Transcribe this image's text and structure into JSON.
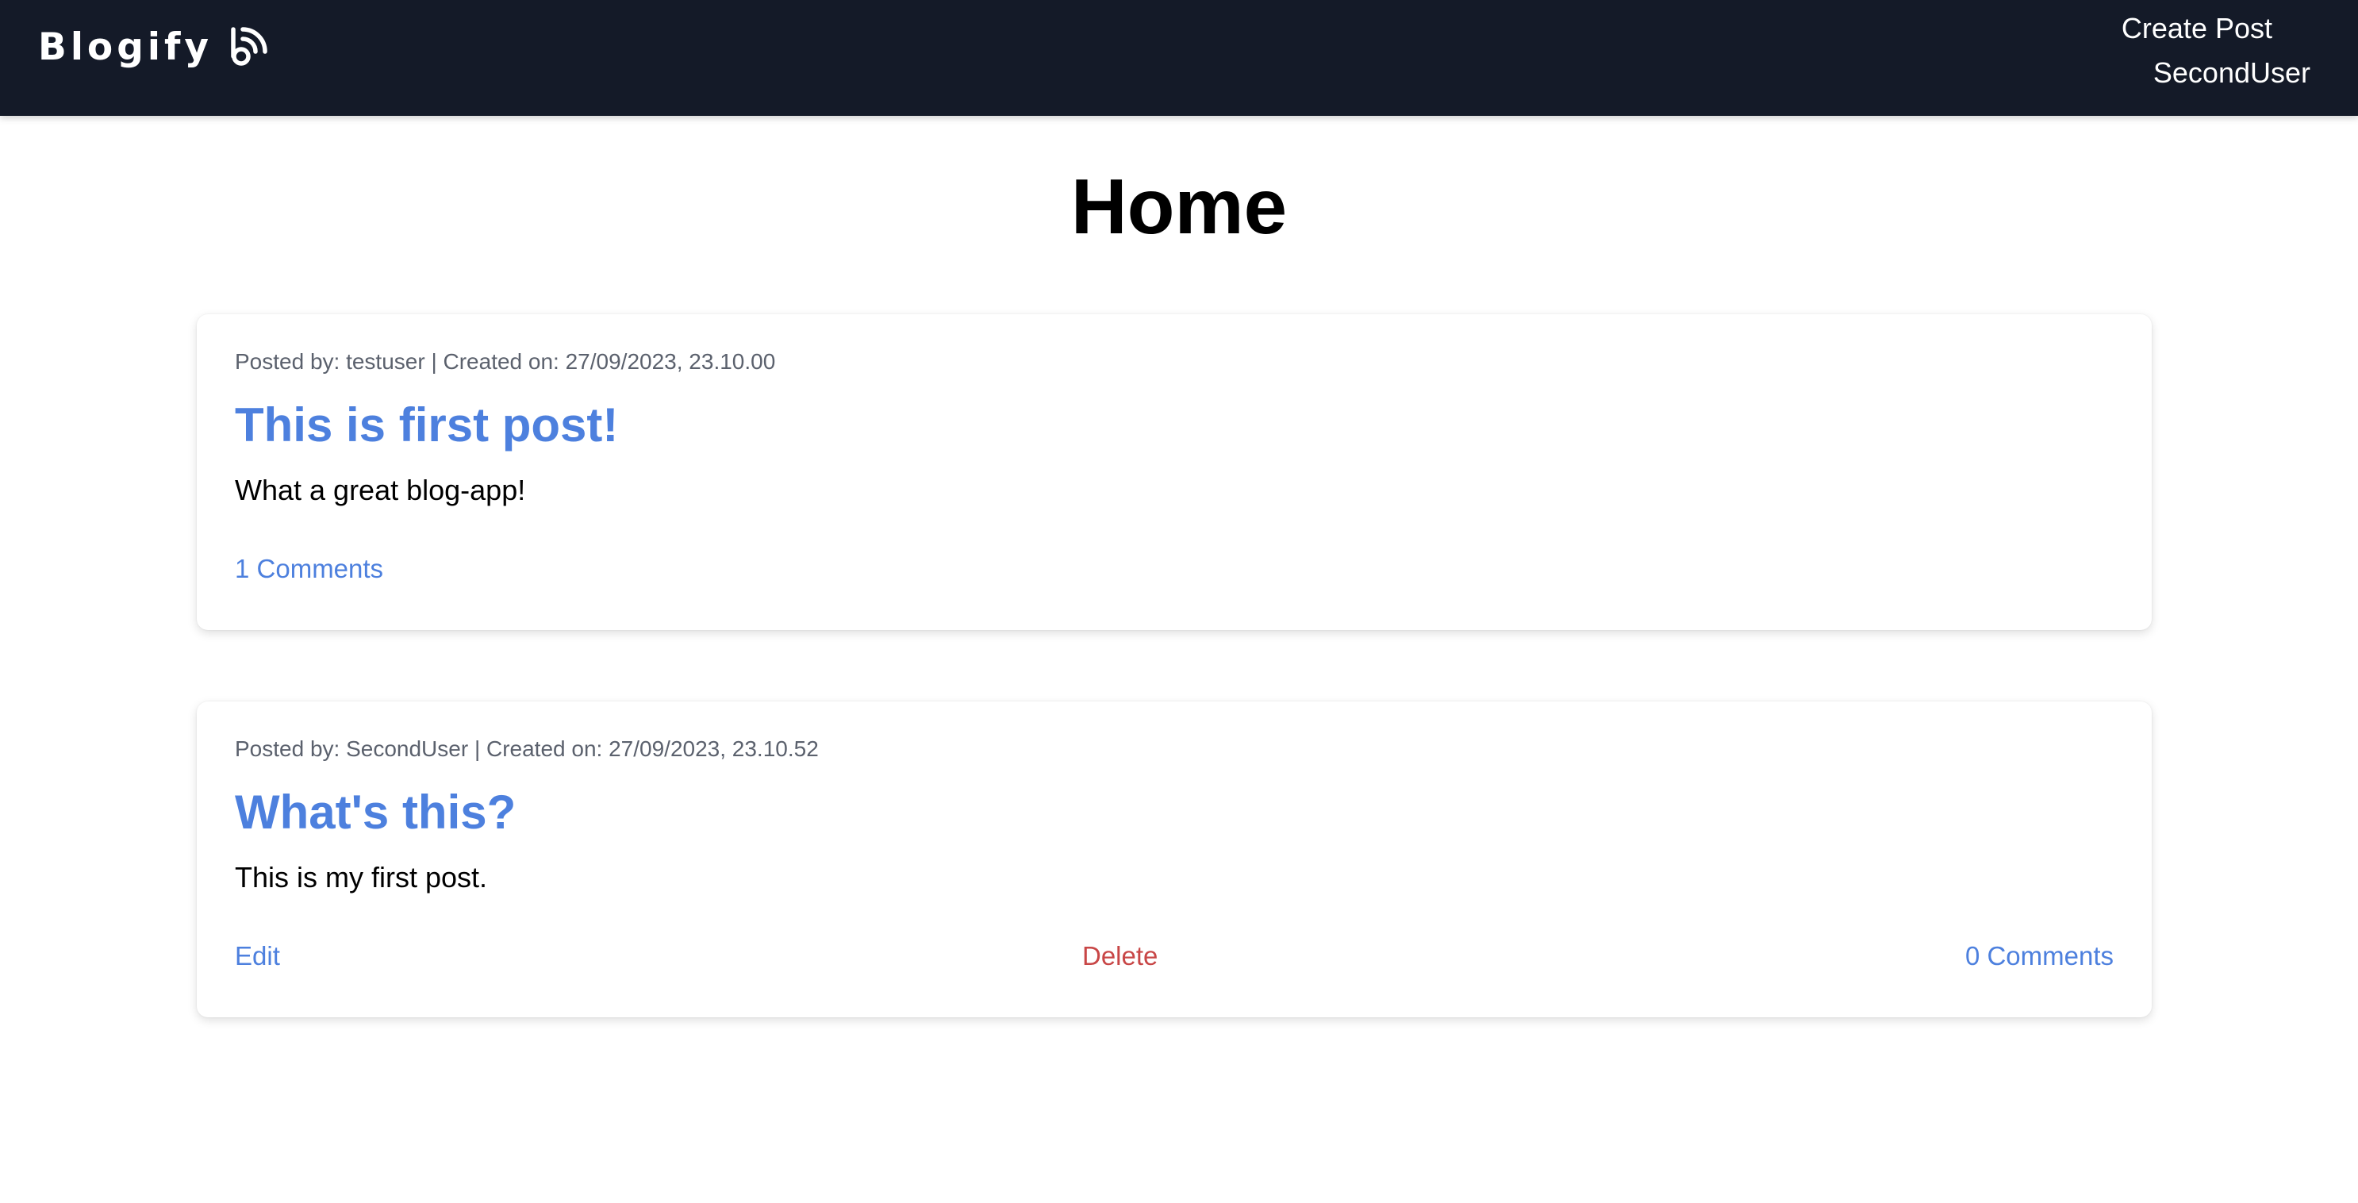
{
  "app": {
    "brand": "Blogify",
    "brand_icon": "rss-feed-icon",
    "colors": {
      "navbar_bg": "#141a28",
      "link_blue": "#4d80de",
      "delete_red": "#c84646",
      "meta_gray": "#5b616d"
    }
  },
  "nav": {
    "create_post": "Create Post",
    "username": "SecondUser"
  },
  "page": {
    "title": "Home"
  },
  "posts": [
    {
      "meta": "Posted by: testuser | Created on: 27/09/2023, 23.10.00",
      "title": "This is first post!",
      "body": "What a great blog-app!",
      "comments": "1 Comments"
    },
    {
      "meta": "Posted by: SecondUser | Created on: 27/09/2023, 23.10.52",
      "title": "What's this?",
      "body": "This is my first post.",
      "edit": "Edit",
      "delete": "Delete",
      "comments": "0 Comments"
    }
  ]
}
